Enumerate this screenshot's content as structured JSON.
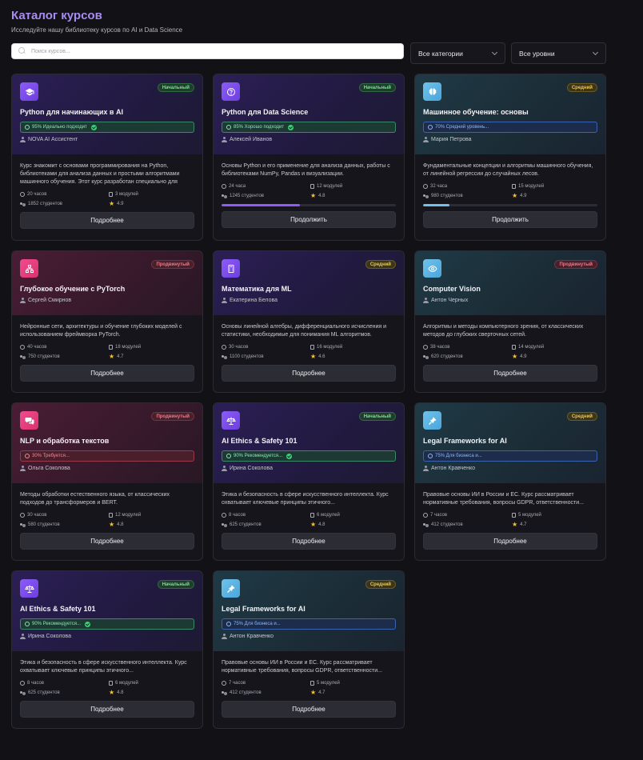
{
  "header": {
    "title": "Каталог курсов",
    "subtitle": "Исследуйте нашу библиотеку курсов по AI и Data Science"
  },
  "filters": {
    "search_placeholder": "Поиск курсов...",
    "category": "Все категории",
    "level": "Все уровни"
  },
  "colors": {
    "accent": "#a98cf2",
    "progress_purple": "#8b5cf6",
    "progress_blue": "#6fc1ea",
    "star": "#f4c430"
  },
  "courses": [
    {
      "icon": "graduation-cap-icon",
      "level": "Начальный",
      "title": "Python для начинающих в AI",
      "match": "95% Идеально подходит",
      "author": "NOVA AI Ассистент",
      "description": "Курс знакомит с основами программирования на Python, библиотеками для анализа данных и простыми алгоритмами машинного обучения. Этот курс разработан специально для",
      "hours": "20 часов",
      "modules": "3 модулей",
      "students": "1852 студентов",
      "rating": "4.9",
      "button": "Подробнее"
    },
    {
      "icon": "help-circle-icon",
      "level": "Начальный",
      "title": "Python для Data Science",
      "match": "85% Хорошо подходит",
      "author": "Алексей Иванов",
      "description": "Основы Python и его применение для анализа данных, работы с библиотеками NumPy, Pandas и визуализации.",
      "hours": "24 часа",
      "modules": "12 модулей",
      "students": "1245 студентов",
      "rating": "4.8",
      "progress": 0.45,
      "button": "Продолжить"
    },
    {
      "icon": "brain-icon",
      "level": "Средний",
      "title": "Машинное обучение: основы",
      "match": "70% Средний уровень...",
      "author": "Мария Петрова",
      "description": "Фундаментальные концепции и алгоритмы машинного обучения, от линейной регрессии до случайных лесов.",
      "hours": "32 часа",
      "modules": "15 модулей",
      "students": "980 студентов",
      "rating": "4.9",
      "progress": 0.15,
      "button": "Продолжить"
    },
    {
      "icon": "network-icon",
      "level": "Продвинутый",
      "title": "Глубокое обучение с PyTorch",
      "author": "Сергей Смирнов",
      "description": "Нейронные сети, архитектуры и обучение глубоких моделей с использованием фреймворка PyTorch.",
      "hours": "40 часов",
      "modules": "18 модулей",
      "students": "750 студентов",
      "rating": "4.7",
      "button": "Подробнее"
    },
    {
      "icon": "calculator-icon",
      "level": "Средний",
      "title": "Математика для ML",
      "author": "Екатерина Белова",
      "description": "Основы линейной алгебры, дифференциального исчисления и статистики, необходимые для понимания ML алгоритмов.",
      "hours": "30 часов",
      "modules": "16 модулей",
      "students": "1100 студентов",
      "rating": "4.6",
      "button": "Подробнее"
    },
    {
      "icon": "eye-icon",
      "level": "Продвинутый",
      "title": "Computer Vision",
      "author": "Антон Черных",
      "description": "Алгоритмы и методы компьютерного зрения, от классических методов до глубоких сверточных сетей.",
      "hours": "38 часов",
      "modules": "14 модулей",
      "students": "620 студентов",
      "rating": "4.9",
      "button": "Подробнее"
    },
    {
      "icon": "chat-icon",
      "level": "Продвинутый",
      "title": "NLP и обработка текстов",
      "match": "30% Требуется...",
      "author": "Ольга Соколова",
      "description": "Методы обработки естественного языка, от классических подходов до трансформеров и BERT.",
      "hours": "30 часов",
      "modules": "12 модулей",
      "students": "580 студентов",
      "rating": "4.8",
      "button": "Подробнее"
    },
    {
      "icon": "scale-icon",
      "level": "Начальный",
      "title": "AI Ethics & Safety 101",
      "match": "90% Рекомендуется...",
      "author": "Ирина Соколова",
      "description": "Этика и безопасность в сфере искусственного интеллекта. Курс охватывает ключевые принципы этичного...",
      "hours": "8 часов",
      "modules": "6 модулей",
      "students": "625 студентов",
      "rating": "4.8",
      "button": "Подробнее"
    },
    {
      "icon": "gavel-icon",
      "level": "Средний",
      "title": "Legal Frameworks for AI",
      "match": "75% Для бизнеса и...",
      "author": "Антон Кравченко",
      "description": "Правовые основы ИИ в России и ЕС. Курс рассматривает нормативные требования, вопросы GDPR, ответственности...",
      "hours": "7 часов",
      "modules": "5 модулей",
      "students": "412 студентов",
      "rating": "4.7",
      "button": "Подробнее"
    },
    {
      "icon": "scale-icon",
      "level": "Начальный",
      "title": "AI Ethics & Safety 101",
      "match": "90% Рекомендуется...",
      "author": "Ирина Соколова",
      "description": "Этика и безопасность в сфере искусственного интеллекта. Курс охватывает ключевые принципы этичного...",
      "hours": "8 часов",
      "modules": "6 модулей",
      "students": "625 студентов",
      "rating": "4.8",
      "button": "Подробнее"
    },
    {
      "icon": "gavel-icon",
      "level": "Средний",
      "title": "Legal Frameworks for AI",
      "match": "75% Для бизнеса и...",
      "author": "Антон Кравченко",
      "description": "Правовые основы ИИ в России и ЕС. Курс рассматривает нормативные требования, вопросы GDPR, ответственности...",
      "hours": "7 часов",
      "modules": "5 модулей",
      "students": "412 студентов",
      "rating": "4.7",
      "button": "Подробнее"
    }
  ]
}
